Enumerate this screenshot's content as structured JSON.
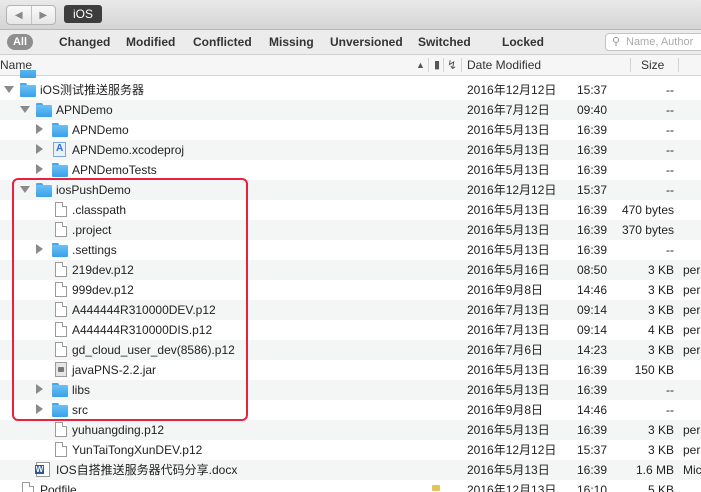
{
  "toolbar": {
    "back_glyph": "◀",
    "forward_glyph": "▶",
    "path_label": "iOS"
  },
  "filters": {
    "all": "All",
    "items": [
      "Changed",
      "Modified",
      "Conflicted",
      "Missing",
      "Unversioned",
      "Switched",
      "Locked"
    ]
  },
  "search": {
    "placeholder": "Name, Author"
  },
  "columns": {
    "name": "Name",
    "date_modified": "Date Modified",
    "size": "Size"
  },
  "rows": [
    {
      "name": "",
      "date": "",
      "time": "",
      "size": "",
      "extra": ""
    },
    {
      "name": "iOS测试推送服务器",
      "date": "2016年12月12日",
      "time": "15:37",
      "size": "--",
      "extra": ""
    },
    {
      "name": "APNDemo",
      "date": "2016年7月12日",
      "time": "09:40",
      "size": "--",
      "extra": ""
    },
    {
      "name": "APNDemo",
      "date": "2016年5月13日",
      "time": "16:39",
      "size": "--",
      "extra": ""
    },
    {
      "name": "APNDemo.xcodeproj",
      "date": "2016年5月13日",
      "time": "16:39",
      "size": "--",
      "extra": ""
    },
    {
      "name": "APNDemoTests",
      "date": "2016年5月13日",
      "time": "16:39",
      "size": "--",
      "extra": ""
    },
    {
      "name": "iosPushDemo",
      "date": "2016年12月12日",
      "time": "15:37",
      "size": "--",
      "extra": ""
    },
    {
      "name": ".classpath",
      "date": "2016年5月13日",
      "time": "16:39",
      "size": "470 bytes",
      "extra": ""
    },
    {
      "name": ".project",
      "date": "2016年5月13日",
      "time": "16:39",
      "size": "370 bytes",
      "extra": ""
    },
    {
      "name": ".settings",
      "date": "2016年5月13日",
      "time": "16:39",
      "size": "--",
      "extra": ""
    },
    {
      "name": "219dev.p12",
      "date": "2016年5月16日",
      "time": "08:50",
      "size": "3 KB",
      "extra": "pers"
    },
    {
      "name": "999dev.p12",
      "date": "2016年9月8日",
      "time": "14:46",
      "size": "3 KB",
      "extra": "pers"
    },
    {
      "name": "A444444R310000DEV.p12",
      "date": "2016年7月13日",
      "time": "09:14",
      "size": "3 KB",
      "extra": "pers"
    },
    {
      "name": "A444444R310000DIS.p12",
      "date": "2016年7月13日",
      "time": "09:14",
      "size": "4 KB",
      "extra": "pers"
    },
    {
      "name": "gd_cloud_user_dev(8586).p12",
      "date": "2016年7月6日",
      "time": "14:23",
      "size": "3 KB",
      "extra": "pers"
    },
    {
      "name": "javaPNS-2.2.jar",
      "date": "2016年5月13日",
      "time": "16:39",
      "size": "150 KB",
      "extra": ""
    },
    {
      "name": "libs",
      "date": "2016年5月13日",
      "time": "16:39",
      "size": "--",
      "extra": ""
    },
    {
      "name": "src",
      "date": "2016年9月8日",
      "time": "14:46",
      "size": "--",
      "extra": ""
    },
    {
      "name": "yuhuangding.p12",
      "date": "2016年5月13日",
      "time": "16:39",
      "size": "3 KB",
      "extra": "pers"
    },
    {
      "name": "YunTaiTongXunDEV.p12",
      "date": "2016年12月12日",
      "time": "15:37",
      "size": "3 KB",
      "extra": "pers"
    },
    {
      "name": "IOS自搭推送服务器代码分享.docx",
      "date": "2016年5月13日",
      "time": "16:39",
      "size": "1.6 MB",
      "extra": "Mic"
    },
    {
      "name": "Podfile",
      "date": "2016年12月13日",
      "time": "16:10",
      "size": "5 KB",
      "extra": ""
    }
  ]
}
